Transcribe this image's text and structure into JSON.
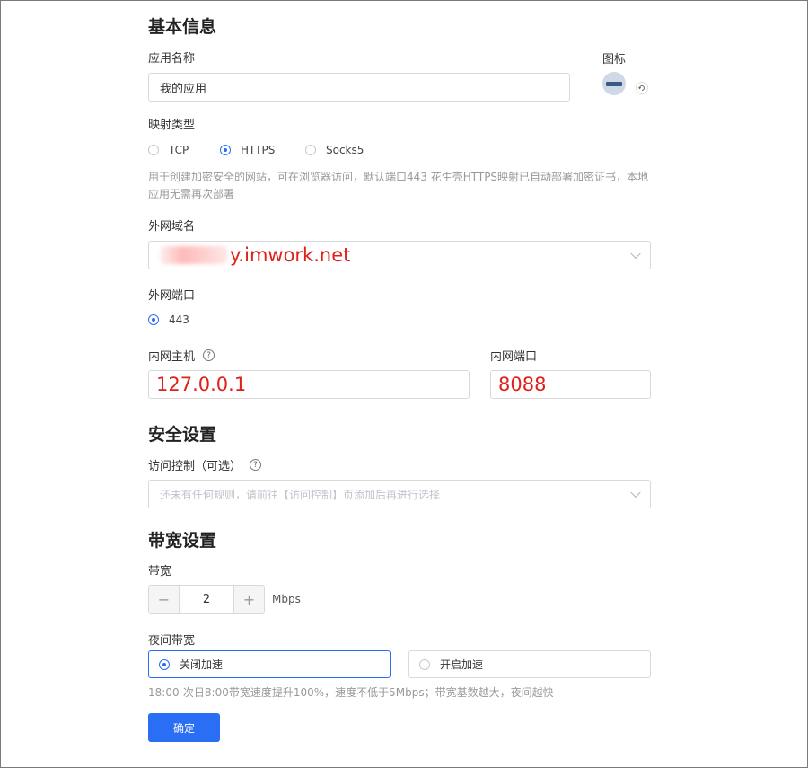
{
  "basic": {
    "title": "基本信息",
    "app_name_label": "应用名称",
    "app_name_value": "我的应用",
    "icon_label": "图标",
    "mapping_type_label": "映射类型",
    "mapping_types": [
      "TCP",
      "HTTPS",
      "Socks5"
    ],
    "mapping_selected": "HTTPS",
    "hint_line1": "用于创建加密安全的网站，可在浏览器访问，默认端口443 花生壳HTTPS映射已自动部署加密证书，本地",
    "hint_line2": "应用无需再次部署",
    "domain_label": "外网域名",
    "domain_value": "y.imwork.net",
    "port_label": "外网端口",
    "port_option": "443",
    "host_label": "内网主机",
    "host_value": "127.0.0.1",
    "inner_port_label": "内网端口",
    "inner_port_value": "8088"
  },
  "security": {
    "title": "安全设置",
    "access_label": "访问控制（可选）",
    "access_placeholder": "还未有任何规则，请前往【访问控制】页添加后再进行选择"
  },
  "bandwidth": {
    "title": "带宽设置",
    "bw_label": "带宽",
    "minus": "−",
    "plus": "+",
    "bw_value": "2",
    "unit": "Mbps",
    "night_label": "夜间带宽",
    "night_off": "关闭加速",
    "night_on": "开启加速",
    "night_hint": "18:00-次日8:00带宽速度提升100%，速度不低于5Mbps；带宽基数越大，夜间越快"
  },
  "actions": {
    "confirm": "确定"
  },
  "colors": {
    "primary": "#2a6ef5",
    "highlight_red": "#e0201a"
  },
  "icons": {
    "app_icon": "app-icon",
    "refresh": "refresh-icon",
    "help": "question-circle-icon",
    "dropdown": "chevron-down-icon"
  }
}
